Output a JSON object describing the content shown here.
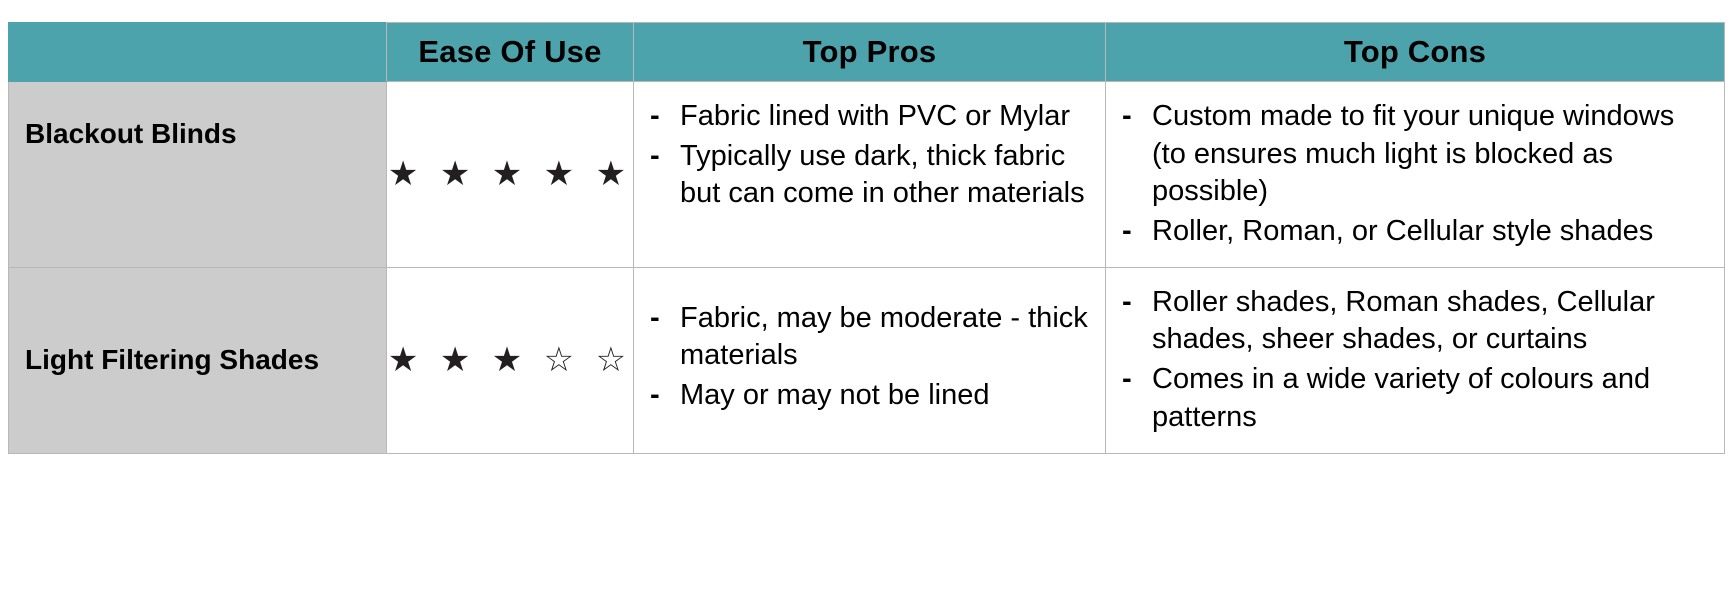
{
  "table": {
    "headers": [
      {
        "label": "",
        "name": "header-blank"
      },
      {
        "label": "Ease Of Use",
        "name": "header-ease-of-use"
      },
      {
        "label": "Top Pros",
        "name": "header-top-pros"
      },
      {
        "label": "Top Cons",
        "name": "header-top-cons"
      }
    ],
    "colors": {
      "header_background": "#4ca3ab",
      "row_label_background": "#cccccc",
      "cell_background": "#ffffff",
      "border": "#b8b8b8",
      "text": "#000000"
    },
    "star_glyphs": {
      "filled": "★",
      "empty": "☆"
    },
    "rows": [
      {
        "label": "Blackout Blinds",
        "rating_filled": 5,
        "rating_total": 5,
        "rating_display": "★ ★ ★ ★ ★",
        "pros": [
          "Fabric lined with PVC or Mylar",
          "Typically use dark, thick fabric but can come in other materials"
        ],
        "cons": [
          "Custom made to fit your unique windows (to ensures much light is blocked as possible)",
          "Roller, Roman, or Cellular style shades"
        ]
      },
      {
        "label": "Light Filtering Shades",
        "rating_filled": 3,
        "rating_total": 5,
        "rating_display": "★ ★ ★ ☆ ☆",
        "pros": [
          "Fabric, may be moderate - thick materials",
          "May or may not be lined"
        ],
        "cons": [
          "Roller shades, Roman shades, Cellular shades, sheer shades, or curtains",
          "Comes in a wide variety of colours and patterns"
        ]
      }
    ],
    "bullet_marker": "-"
  }
}
